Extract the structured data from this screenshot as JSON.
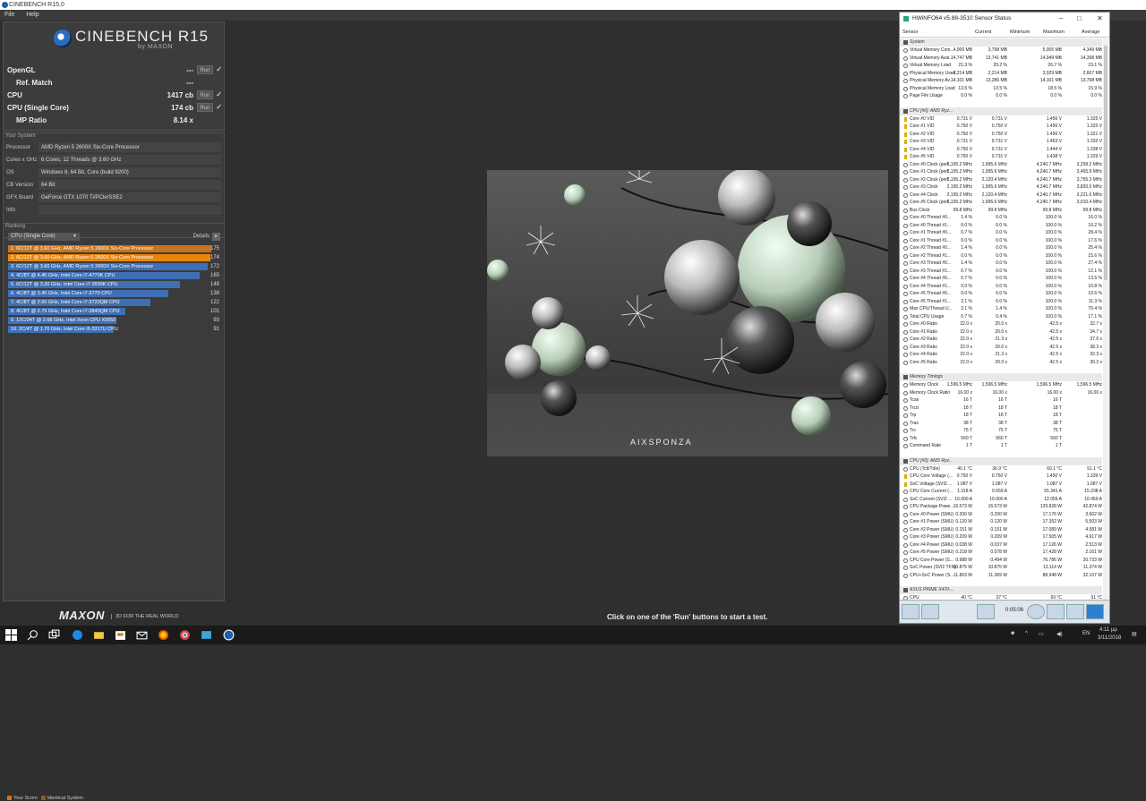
{
  "window": {
    "title": "CINEBENCH R15.0"
  },
  "menu": [
    "File",
    "Help"
  ],
  "logo": {
    "name": "CINEBENCH R15",
    "byline": "by MAXON"
  },
  "scores": [
    {
      "label": "OpenGL",
      "value": "---",
      "run": "Run",
      "check": "✓",
      "indent": false
    },
    {
      "label": "Ref. Match",
      "value": "---",
      "run": "",
      "check": "",
      "indent": true
    },
    {
      "label": "CPU",
      "value": "1417 cb",
      "run": "Run",
      "check": "✓",
      "indent": false
    },
    {
      "label": "CPU (Single Core)",
      "value": "174 cb",
      "run": "Run",
      "check": "✓",
      "indent": false
    },
    {
      "label": "MP Ratio",
      "value": "8.14 x",
      "run": "",
      "check": "",
      "indent": true
    }
  ],
  "system": {
    "title": "Your System",
    "rows": [
      {
        "k": "Processor",
        "v": "AMD Ryzen 5 2600X Six-Core Processor"
      },
      {
        "k": "Cores x GHz",
        "v": "6 Cores, 12 Threads @ 3.60 GHz"
      },
      {
        "k": "OS",
        "v": "Windows 8, 64 Bit, Core (build 9200)"
      },
      {
        "k": "CB Version",
        "v": "64 Bit"
      },
      {
        "k": "GFX Board",
        "v": "GeForce GTX 1070 Ti/PCIe/SSE2"
      },
      {
        "k": "Info",
        "v": ""
      }
    ]
  },
  "ranking": {
    "title": "Ranking",
    "select": "CPU (Single Core)",
    "details": "Details",
    "items": [
      {
        "label": "1. 6C/12T @ 3.60 GHz, AMD Ryzen 5 2600X Six-Core Processor",
        "score": 175,
        "color": "#c8741c"
      },
      {
        "label": "2. 6C/12T @ 3.60 GHz, AMD Ryzen 5 2600X Six-Core Processor",
        "score": 174,
        "color": "#e8860c"
      },
      {
        "label": "3. 6C/12T @ 3.60 GHz, AMD Ryzen 5 2600X Six-Core Processor",
        "score": 172,
        "color": "#3f6fb4"
      },
      {
        "label": "4. 4C/8T @ 4.40 GHz, Intel Core i7-4770K CPU",
        "score": 165,
        "color": "#3f6fb4"
      },
      {
        "label": "5. 6C/12T @ 3.30 GHz,  Intel Core i7-3930K CPU",
        "score": 148,
        "color": "#3f6fb4"
      },
      {
        "label": "6. 4C/8T @ 3.40 GHz,  Intel Core i7-3770 CPU",
        "score": 138,
        "color": "#3f6fb4"
      },
      {
        "label": "7. 4C/8T @ 2.60 GHz, Intel Core i7-3720QM CPU",
        "score": 122,
        "color": "#3f6fb4"
      },
      {
        "label": "8. 4C/8T @ 2.79 GHz,  Intel Core i7-3840QM CPU",
        "score": 101,
        "color": "#3f6fb4"
      },
      {
        "label": "9. 12C/24T @ 2.66 GHz, Intel Xeon CPU X5650",
        "score": 93,
        "color": "#3f6fb4"
      },
      {
        "label": "10. 2C/4T @ 1.70 GHz,  Intel Core i5-3317U CPU",
        "score": 91,
        "color": "#3f6fb4"
      }
    ],
    "legend": [
      {
        "label": "Your Score",
        "color": "#c8741c"
      },
      {
        "label": "Identical System",
        "color": "#8a5a2a"
      }
    ]
  },
  "footer": {
    "brand": "MAXON",
    "tagline": "3D FOR THE REAL WORLD",
    "status": "Click on one of the 'Run' buttons to start a test."
  },
  "render": {
    "watermark": "AIXSPONZA"
  },
  "hwinfo": {
    "title": "HWiNFO64 v5.88-3510 Sensor Status",
    "columns": [
      "Sensor",
      "Current",
      "Minimum",
      "Maximum",
      "Average"
    ],
    "timer": "0:05:06",
    "sections": [
      {
        "name": "System",
        "rows": [
          [
            "Virtual Memory Com...",
            "4,000 MB",
            "3,798 MB",
            "5,005 MB",
            "4,349 MB"
          ],
          [
            "Virtual Memory Avai...",
            "14,747 MB",
            "13,741 MB",
            "14,949 MB",
            "14,398 MB"
          ],
          [
            "Virtual Memory Load",
            "21.3 %",
            "20.2 %",
            "26.7 %",
            "23.1 %"
          ],
          [
            "Physical Memory Used",
            "2,214 MB",
            "2,214 MB",
            "3,029 MB",
            "2,607 MB"
          ],
          [
            "Physical Memory Av...",
            "14,101 MB",
            "13,286 MB",
            "14,101 MB",
            "13,708 MB"
          ],
          [
            "Physical Memory Load",
            "13.5 %",
            "13.5 %",
            "18.5 %",
            "15.9 %"
          ],
          [
            "Page File Usage",
            "0.0 %",
            "0.0 %",
            "0.0 %",
            "0.0 %"
          ]
        ]
      },
      {
        "name": "CPU [#0]: AMD Ryz...",
        "rows": [
          [
            "Core #0 VID",
            "0.731 V",
            "0.731 V",
            "1.456 V",
            "1.325 V"
          ],
          [
            "Core #1 VID",
            "0.750 V",
            "0.750 V",
            "1.456 V",
            "1.325 V"
          ],
          [
            "Core #2 VID",
            "0.750 V",
            "0.750 V",
            "1.456 V",
            "1.321 V"
          ],
          [
            "Core #3 VID",
            "0.731 V",
            "0.731 V",
            "1.463 V",
            "1.332 V"
          ],
          [
            "Core #4 VID",
            "0.750 V",
            "0.731 V",
            "1.444 V",
            "1.338 V"
          ],
          [
            "Core #5 VID",
            "0.750 V",
            "0.731 V",
            "1.438 V",
            "1.329 V"
          ],
          [
            "Core #0 Clock (perf...",
            "2,195.2 MHz",
            "1,995.6 MHz",
            "4,240.7 MHz",
            "3,258.2 MHz"
          ],
          [
            "Core #1 Clock (perf...",
            "2,195.2 MHz",
            "1,995.6 MHz",
            "4,240.7 MHz",
            "3,465.9 MHz"
          ],
          [
            "Core #2 Clock (perf...",
            "2,195.2 MHz",
            "2,120.4 MHz",
            "4,240.7 MHz",
            "3,755.3 MHz"
          ],
          [
            "Core #3 Clock",
            "2,195.2 MHz",
            "1,995.6 MHz",
            "4,240.7 MHz",
            "3,820.5 MHz"
          ],
          [
            "Core #4 Clock",
            "2,195.2 MHz",
            "2,120.4 MHz",
            "4,240.7 MHz",
            "3,221.6 MHz"
          ],
          [
            "Core #5 Clock (perf...",
            "2,195.2 MHz",
            "1,995.6 MHz",
            "4,240.7 MHz",
            "3,010.4 MHz"
          ],
          [
            "Bus Clock",
            "99.8 MHz",
            "99.8 MHz",
            "99.8 MHz",
            "99.8 MHz"
          ],
          [
            "Core #0 Thread #0...",
            "1.4 %",
            "0.0 %",
            "100.0 %",
            "16.0 %"
          ],
          [
            "Core #0 Thread #1...",
            "0.0 %",
            "0.0 %",
            "100.0 %",
            "16.2 %"
          ],
          [
            "Core #1 Thread #0...",
            "0.7 %",
            "0.0 %",
            "100.0 %",
            "28.4 %"
          ],
          [
            "Core #1 Thread #1...",
            "0.0 %",
            "0.0 %",
            "100.0 %",
            "17.6 %"
          ],
          [
            "Core #2 Thread #0...",
            "1.4 %",
            "0.0 %",
            "100.0 %",
            "25.4 %"
          ],
          [
            "Core #2 Thread #1...",
            "0.0 %",
            "0.0 %",
            "100.0 %",
            "15.6 %"
          ],
          [
            "Core #3 Thread #0...",
            "1.4 %",
            "0.0 %",
            "100.0 %",
            "27.4 %"
          ],
          [
            "Core #3 Thread #1...",
            "0.7 %",
            "0.0 %",
            "100.0 %",
            "12.1 %"
          ],
          [
            "Core #4 Thread #0...",
            "0.7 %",
            "0.0 %",
            "100.0 %",
            "13.5 %"
          ],
          [
            "Core #4 Thread #1...",
            "0.0 %",
            "0.0 %",
            "100.0 %",
            "10.8 %"
          ],
          [
            "Core #5 Thread #0...",
            "0.0 %",
            "0.0 %",
            "100.0 %",
            "10.6 %"
          ],
          [
            "Core #5 Thread #1...",
            "2.1 %",
            "0.0 %",
            "100.0 %",
            "11.3 %"
          ],
          [
            "Max CPU/Thread U...",
            "2.1 %",
            "1.4 %",
            "100.0 %",
            "70.4 %"
          ],
          [
            "Total CPU Usage",
            "0.7 %",
            "0.4 %",
            "100.0 %",
            "17.1 %"
          ],
          [
            "Core #0 Ratio",
            "22.0 x",
            "20.0 x",
            "42.5 x",
            "32.7 x"
          ],
          [
            "Core #1 Ratio",
            "22.0 x",
            "20.0 x",
            "42.5 x",
            "34.7 x"
          ],
          [
            "Core #2 Ratio",
            "22.0 x",
            "21.3 x",
            "42.5 x",
            "37.6 x"
          ],
          [
            "Core #3 Ratio",
            "22.0 x",
            "20.0 x",
            "42.5 x",
            "38.3 x"
          ],
          [
            "Core #4 Ratio",
            "22.0 x",
            "21.3 x",
            "42.5 x",
            "32.3 x"
          ],
          [
            "Core #5 Ratio",
            "22.0 x",
            "20.0 x",
            "42.5 x",
            "30.2 x"
          ]
        ]
      },
      {
        "name": "Memory Timings",
        "rows": [
          [
            "Memory Clock",
            "1,596.5 MHz",
            "1,596.5 MHz",
            "1,596.5 MHz",
            "1,596.5 MHz"
          ],
          [
            "Memory Clock Ratio",
            "16.00 x",
            "16.00 x",
            "16.00 x",
            "16.00 x"
          ],
          [
            "Tcas",
            "16 T",
            "16 T",
            "16 T",
            ""
          ],
          [
            "Trcd",
            "18 T",
            "18 T",
            "18 T",
            ""
          ],
          [
            "Trp",
            "18 T",
            "18 T",
            "18 T",
            ""
          ],
          [
            "Tras",
            "38 T",
            "38 T",
            "38 T",
            ""
          ],
          [
            "Trc",
            "75 T",
            "75 T",
            "75 T",
            ""
          ],
          [
            "Trfc",
            "560 T",
            "560 T",
            "560 T",
            ""
          ],
          [
            "Command Rate",
            "1 T",
            "1 T",
            "1 T",
            ""
          ]
        ]
      },
      {
        "name": "CPU [#0]: AMD Ryz...",
        "rows": [
          [
            "CPU (Tctl/Tdie)",
            "40.1 °C",
            "36.9 °C",
            "69.1 °C",
            "51.1 °C"
          ],
          [
            "CPU Core Voltage (...",
            "0.750 V",
            "0.750 V",
            "1.450 V",
            "1.339 V"
          ],
          [
            "SoC Voltage (SVI2 ...",
            "1.087 V",
            "1.087 V",
            "1.087 V",
            "1.087 V"
          ],
          [
            "CPU Core Current (...",
            "1.318 A",
            "0.659 A",
            "55.341 A",
            "15.238 A"
          ],
          [
            "SoC Current (SVI2 ...",
            "10.000 A",
            "10.000 A",
            "12.059 A",
            "10.459 A"
          ],
          [
            "CPU Package Powe...",
            "16.573 W",
            "16.573 W",
            "129.828 W",
            "42.874 W"
          ],
          [
            "Core #0 Power (SMU)",
            "0.200 W",
            "0.200 W",
            "17.176 W",
            "3.662 W"
          ],
          [
            "Core #1 Power (SMU)",
            "0.120 W",
            "0.120 W",
            "17.352 W",
            "5.503 W"
          ],
          [
            "Core #2 Power (SMU)",
            "0.151 W",
            "0.151 W",
            "17.089 W",
            "4.581 W"
          ],
          [
            "Core #3 Power (SMU)",
            "0.209 W",
            "0.209 W",
            "17.505 W",
            "4.617 W"
          ],
          [
            "Core #4 Power (SMU)",
            "0.038 W",
            "0.037 W",
            "17.126 W",
            "2.513 W"
          ],
          [
            "Core #5 Power (SMU)",
            "0.218 W",
            "0.078 W",
            "17.428 W",
            "2.161 W"
          ],
          [
            "CPU Core Power (S...",
            "0.988 W",
            "0.494 W",
            "76.786 W",
            "20.733 W"
          ],
          [
            "SoC Power (SVI2 TFN)",
            "10.875 W",
            "10.875 W",
            "13.114 W",
            "11.374 W"
          ],
          [
            "CPU+SoC Power (S...",
            "11.863 W",
            "11.369 W",
            "88.948 W",
            "32.107 W"
          ]
        ]
      },
      {
        "name": "ASUS PRIME X470-...",
        "rows": [
          [
            "CPU",
            "40 °C",
            "37 °C",
            "69 °C",
            "51 °C"
          ]
        ]
      }
    ]
  },
  "taskbar": {
    "lang": "EN",
    "time": "4:11 μμ",
    "date": "3/11/2018"
  }
}
